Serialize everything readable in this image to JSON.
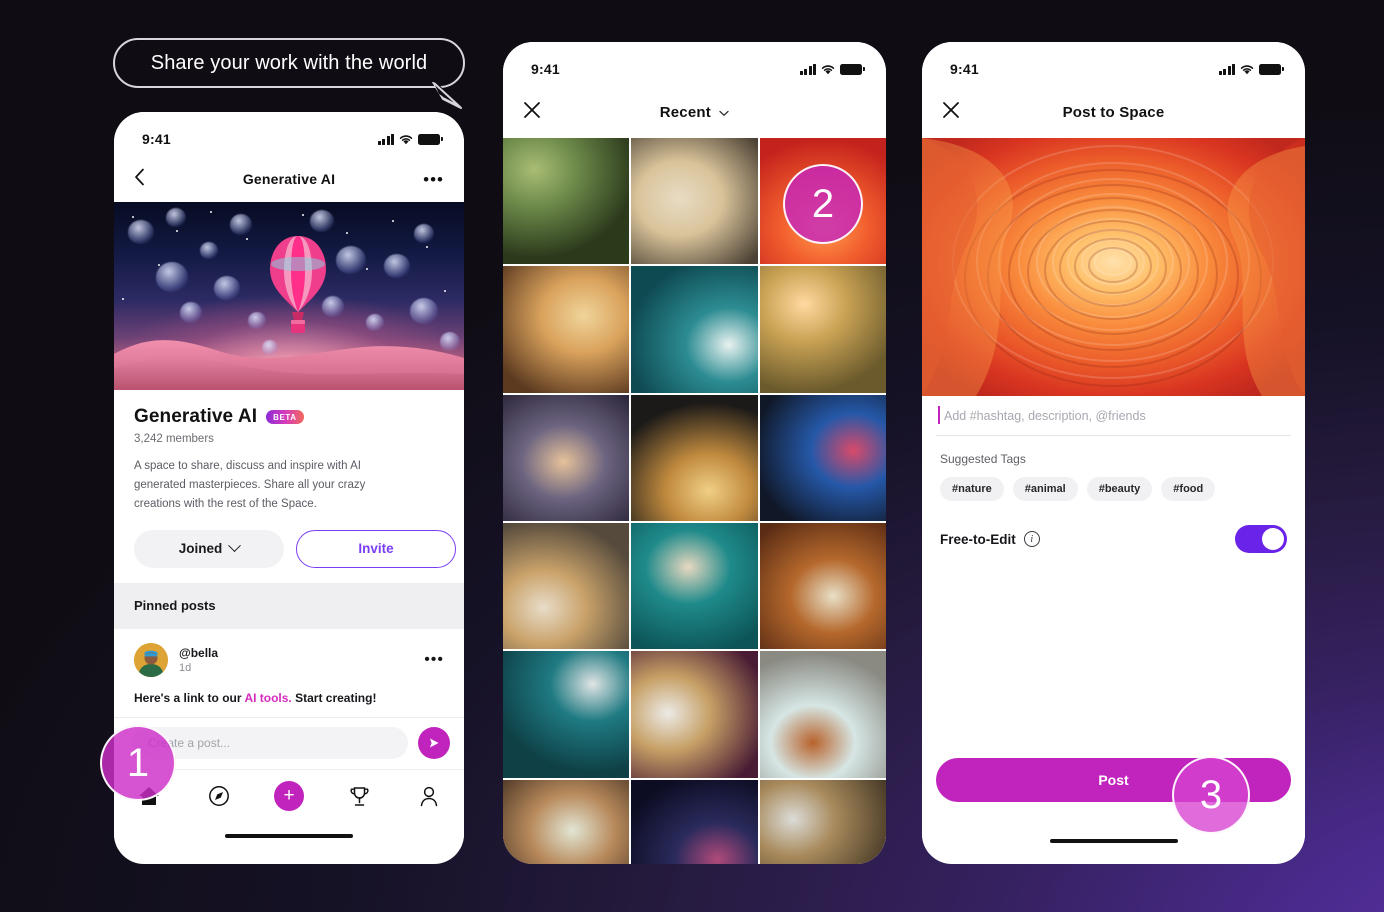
{
  "background": {
    "top_left": "#0f0c0e",
    "bottom_right": "#4a2a8c",
    "accent_magenta": "#c024bd",
    "accent_purple": "#7b3ff2"
  },
  "callout": {
    "text": "Share your work with the world"
  },
  "steps": [
    {
      "id": "step-1",
      "label": "1"
    },
    {
      "id": "step-2",
      "label": "2"
    },
    {
      "id": "step-3",
      "label": "3"
    }
  ],
  "phone1": {
    "status": {
      "time": "9:41",
      "signal_icon": "signal-bars-icon",
      "wifi_icon": "wifi-icon",
      "battery_icon": "battery-icon"
    },
    "nav": {
      "back_icon": "chevron-left-icon",
      "title": "Generative AI",
      "more_icon": "more-horizontal-icon"
    },
    "hero": {
      "alt": "hot-air-balloon-over-pink-dunes-with-jellyfish"
    },
    "space": {
      "title": "Generative AI",
      "badge": "BETA",
      "members": "3,242 members",
      "about": "A space to share, discuss and inspire with AI generated masterpieces. Share all your crazy creations with the rest of the Space.",
      "joined_label": "Joined",
      "invite_label": "Invite"
    },
    "pinned": {
      "header": "Pinned posts"
    },
    "post": {
      "handle": "@bella",
      "time_ago": "1d",
      "body_before": "Here's a link to our ",
      "body_link": "AI tools.",
      "body_after": " Start creating!",
      "more_icon": "more-horizontal-icon"
    },
    "composer": {
      "placeholder": "Create a post...",
      "send_icon": "send-icon"
    },
    "tabbar": [
      {
        "name": "home",
        "icon": "home-icon",
        "active": true
      },
      {
        "name": "explore",
        "icon": "compass-icon",
        "active": false
      },
      {
        "name": "create",
        "icon": "plus-icon",
        "active": false
      },
      {
        "name": "awards",
        "icon": "trophy-icon",
        "active": false
      },
      {
        "name": "profile",
        "icon": "person-icon",
        "active": false
      }
    ]
  },
  "phone2": {
    "status": {
      "time": "9:41"
    },
    "nav": {
      "close_icon": "close-icon",
      "title": "Recent",
      "chevron_icon": "chevron-down-icon"
    },
    "grid": [
      {
        "alt": "forest-path",
        "c1": "#6d8a4a",
        "c2": "#2c3a1c",
        "c3": "#a9bd74"
      },
      {
        "alt": "puppy-with-stick",
        "c1": "#d9c39a",
        "c2": "#4b4134",
        "c3": "#e8dcc4"
      },
      {
        "alt": "orange-paper-art",
        "c1": "#f25f2e",
        "c2": "#c4221c",
        "c3": "#ff9c4e"
      },
      {
        "alt": "pizza-on-board",
        "c1": "#d9a25c",
        "c2": "#5c3a20",
        "c3": "#f0d49a"
      },
      {
        "alt": "teal-marble-swirl",
        "c1": "#2c8c92",
        "c2": "#0e4a52",
        "c3": "#e8f2f0"
      },
      {
        "alt": "golden-field-sunset",
        "c1": "#c9a254",
        "c2": "#6a5a2c",
        "c3": "#ffd9a0"
      },
      {
        "alt": "lake-at-dusk",
        "c1": "#6c6480",
        "c2": "#2a2438",
        "c3": "#e6c29a"
      },
      {
        "alt": "french-toast-berries",
        "c1": "#c08a3e",
        "c2": "#1c1a18",
        "c3": "#f0cf86"
      },
      {
        "alt": "blue-pink-marble",
        "c1": "#2558a8",
        "c2": "#101828",
        "c3": "#d94a6a"
      },
      {
        "alt": "golden-retriever",
        "c1": "#c9a26a",
        "c2": "#554a3c",
        "c3": "#e8dcc8"
      },
      {
        "alt": "ocean-wave-aerial",
        "c1": "#1f8a8a",
        "c2": "#0c5456",
        "c3": "#e8d8c0"
      },
      {
        "alt": "ramen-bowl",
        "c1": "#b5682c",
        "c2": "#5a2c14",
        "c3": "#e8e0c8"
      },
      {
        "alt": "pendant-lamp-teal",
        "c1": "#1f7a82",
        "c2": "#0e4046",
        "c3": "#e0e4e4"
      },
      {
        "alt": "burger-on-marble",
        "c1": "#c6a066",
        "c2": "#4a1c34",
        "c3": "#eceae6"
      },
      {
        "alt": "coffee-cup-flatlay",
        "c1": "#d6e6e4",
        "c2": "#8a8a82",
        "c3": "#b8632c"
      },
      {
        "alt": "dessert-jar",
        "c1": "#b88a5c",
        "c2": "#3c2a1c",
        "c3": "#e2e6d4"
      },
      {
        "alt": "galaxy-night-sky",
        "c1": "#2a2a5c",
        "c2": "#0c0c22",
        "c3": "#b04a7a"
      },
      {
        "alt": "dog-by-window",
        "c1": "#a88a5c",
        "c2": "#4a3c28",
        "c3": "#dcdcd8"
      }
    ]
  },
  "phone3": {
    "status": {
      "time": "9:41"
    },
    "nav": {
      "close_icon": "close-icon",
      "title": "Post to Space"
    },
    "hero": {
      "alt": "orange-paper-spiral-art"
    },
    "caption": {
      "placeholder": "Add #hashtag, description, @friends",
      "value": ""
    },
    "suggested": {
      "label": "Suggested Tags",
      "tags": [
        "#nature",
        "#animal",
        "#beauty",
        "#food"
      ]
    },
    "free_to_edit": {
      "label": "Free-to-Edit",
      "info_icon": "info-icon",
      "enabled": true
    },
    "post_button": {
      "label": "Post"
    }
  }
}
